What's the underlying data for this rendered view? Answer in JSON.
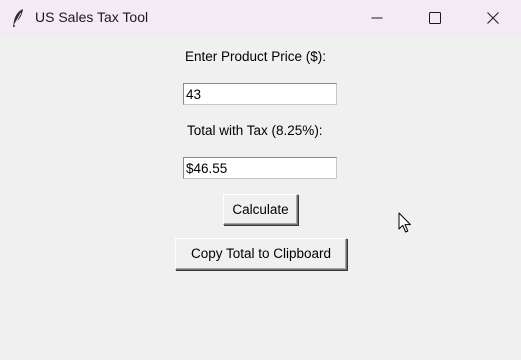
{
  "window": {
    "title": "US Sales Tax Tool",
    "app_icon": "feather-icon",
    "controls": [
      "minimize-icon",
      "maximize-icon",
      "close-icon"
    ]
  },
  "form": {
    "price_label": "Enter Product Price ($):",
    "price_value": "43",
    "total_label": "Total with Tax (8.25%):",
    "total_value": "$46.55"
  },
  "buttons": {
    "calculate_label": "Calculate",
    "copy_label": "Copy Total to Clipboard"
  },
  "colors": {
    "titlebar": "#f3ebf4",
    "background": "#f0f0f0",
    "entry_background": "#ffffff"
  }
}
